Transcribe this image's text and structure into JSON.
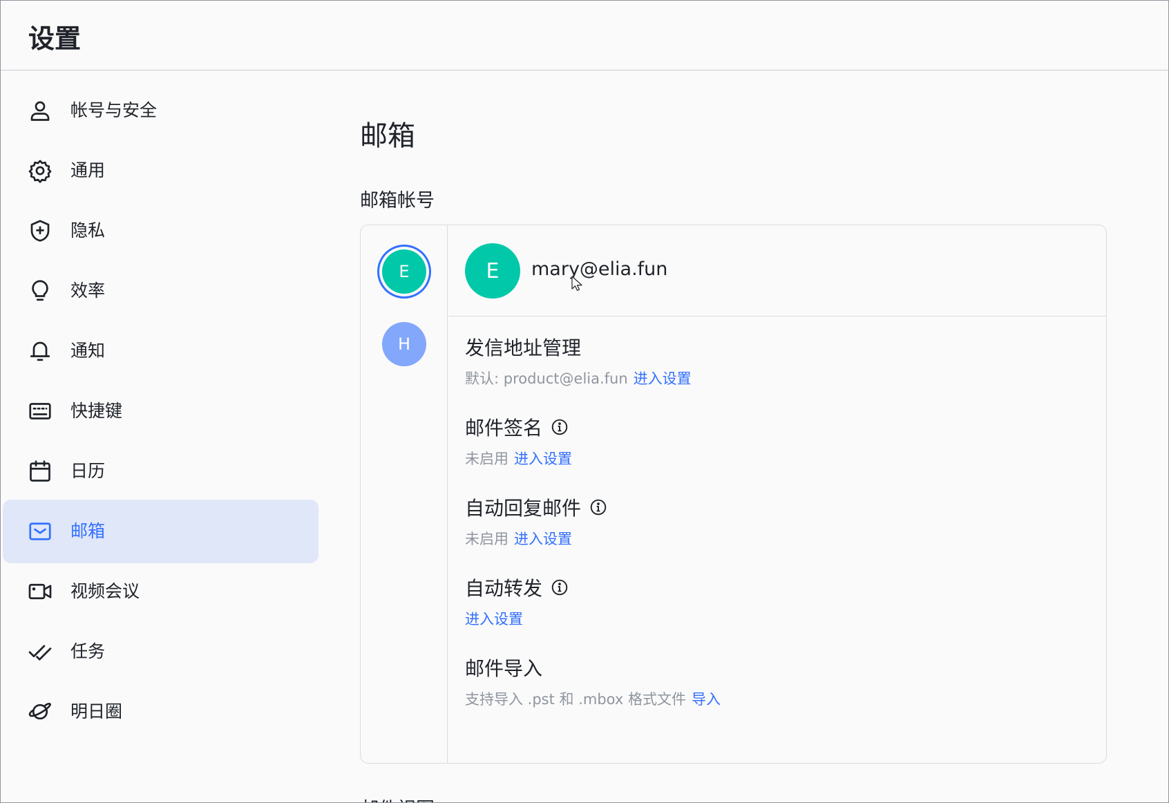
{
  "window": {
    "title": "设置"
  },
  "sidebar": {
    "items": [
      {
        "label": "帐号与安全",
        "icon": "user-icon",
        "active": false
      },
      {
        "label": "通用",
        "icon": "gear-icon",
        "active": false
      },
      {
        "label": "隐私",
        "icon": "shield-plus-icon",
        "active": false
      },
      {
        "label": "效率",
        "icon": "lightbulb-icon",
        "active": false
      },
      {
        "label": "通知",
        "icon": "bell-icon",
        "active": false
      },
      {
        "label": "快捷键",
        "icon": "keyboard-icon",
        "active": false
      },
      {
        "label": "日历",
        "icon": "calendar-icon",
        "active": false
      },
      {
        "label": "邮箱",
        "icon": "mail-icon",
        "active": true
      },
      {
        "label": "视频会议",
        "icon": "video-camera-icon",
        "active": false
      },
      {
        "label": "任务",
        "icon": "double-check-icon",
        "active": false
      },
      {
        "label": "明日圈",
        "icon": "planet-icon",
        "active": false
      }
    ]
  },
  "main": {
    "page_title": "邮箱",
    "section_label": "邮箱帐号",
    "accounts": [
      {
        "initial": "E",
        "color": "#00c8a8",
        "selected": true
      },
      {
        "initial": "H",
        "color": "#82a7fb",
        "selected": false
      }
    ],
    "selected_account": {
      "initial": "E",
      "email": "mary@elia.fun",
      "color": "#00c8a8"
    },
    "options": {
      "sender": {
        "title": "发信地址管理",
        "prefix": "默认: product@elia.fun",
        "link": "进入设置"
      },
      "signature": {
        "title": "邮件签名",
        "status": "未启用",
        "link": "进入设置"
      },
      "auto_reply": {
        "title": "自动回复邮件",
        "status": "未启用",
        "link": "进入设置"
      },
      "auto_forward": {
        "title": "自动转发",
        "link": "进入设置"
      },
      "import": {
        "title": "邮件导入",
        "desc": "支持导入 .pst 和 .mbox 格式文件",
        "link": "导入"
      }
    },
    "next_section_label": "邮件视图"
  },
  "colors": {
    "accent": "#3370ff",
    "active_bg": "#dfe7f8",
    "muted": "#8f959e"
  }
}
